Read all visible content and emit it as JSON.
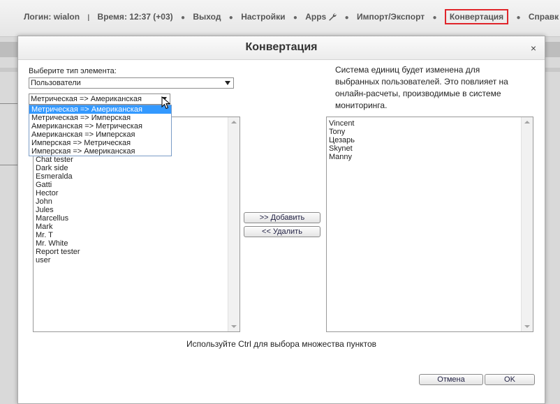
{
  "topbar": {
    "login": "Логин: wialon",
    "time": "Время: 12:37 (+03)",
    "items": [
      "Выход",
      "Настройки",
      "Apps",
      "Импорт/Экспорт",
      "Конвертация",
      "Справк"
    ],
    "separator": "●",
    "active_color": "#e0252b"
  },
  "dialog": {
    "title": "Конвертация",
    "close": "×",
    "element_type_label": "Выберите тип элемента:",
    "element_type_value": "Пользователи",
    "conversion_value": "Метрическая => Американская",
    "conversion_options": [
      "Метрическая => Американская",
      "Метрическая => Имперская",
      "Американская => Метрическая",
      "Американская => Имперская",
      "Имперская => Метрическая",
      "Имперская => Американская"
    ],
    "info_text_lines": [
      "Система единиц будет изменена для",
      "выбранных пользователей. Это повлияет на",
      "онлайн-расчеты, производимые в системе",
      "мониторинга."
    ],
    "available_list": [
      "Chat tester",
      "Dark side",
      "Esmeralda",
      "Gatti",
      "Hector",
      "John",
      "Jules",
      "Marcellus",
      "Mark",
      "Mr. T",
      "Mr. White",
      "Report tester",
      "user"
    ],
    "selected_list": [
      "Vincent",
      "Tony",
      "Цезарь",
      "Skynet",
      "Manny"
    ],
    "add_button": ">> Добавить",
    "remove_button": "<< Удалить",
    "hint": "Используйте Ctrl для выбора множества пунктов",
    "cancel_button": "Отмена",
    "ok_button": "OK",
    "highlight_color": "#3399ff"
  }
}
